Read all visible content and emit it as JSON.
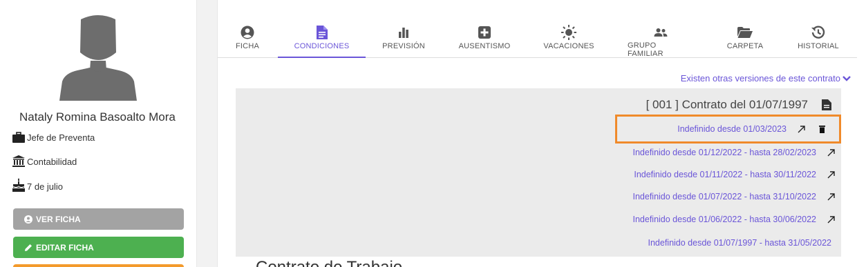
{
  "profile": {
    "name": "Nataly Romina Basoalto Mora",
    "position": "Jefe de Preventa",
    "department": "Contabilidad",
    "birthday": "7 de julio",
    "icons": [
      "user-silhouette",
      "briefcase-icon",
      "bank-icon",
      "cake-icon"
    ],
    "buttons": {
      "view_label": "VER FICHA",
      "edit_label": "EDITAR FICHA"
    },
    "colors": {
      "grey_button": "#a3a3a3",
      "green_button": "#4db050",
      "orange_button": "#f39a2c"
    }
  },
  "tabs": [
    {
      "label": "FICHA",
      "icon": "user-circle-icon",
      "active": false
    },
    {
      "label": "CONDICIONES",
      "icon": "file-text-icon",
      "active": true
    },
    {
      "label": "PREVISIÓN",
      "icon": "bar-chart-icon",
      "active": false
    },
    {
      "label": "AUSENTISMO",
      "icon": "plus-square-icon",
      "active": false
    },
    {
      "label": "VACACIONES",
      "icon": "sun-icon",
      "active": false
    },
    {
      "label": "GRUPO FAMILIAR",
      "icon": "users-icon",
      "active": false
    },
    {
      "label": "CARPETA",
      "icon": "folder-open-icon",
      "active": false
    },
    {
      "label": "HISTORIAL",
      "icon": "history-icon",
      "active": false
    }
  ],
  "versions_link": "Existen otras versiones de este contrato",
  "contract": {
    "title": "[ 001 ] Contrato del 01/07/1997",
    "periods": [
      {
        "label": "Indefinido desde 01/03/2023",
        "actions": [
          "expand-icon",
          "trash-icon"
        ],
        "highlighted": true
      },
      {
        "label": "Indefinido desde 01/12/2022 - hasta 28/02/2023",
        "actions": [
          "expand-icon"
        ]
      },
      {
        "label": "Indefinido desde 01/11/2022 - hasta 30/11/2022",
        "actions": [
          "expand-icon"
        ]
      },
      {
        "label": "Indefinido desde 01/07/2022 - hasta 31/10/2022",
        "actions": [
          "expand-icon"
        ]
      },
      {
        "label": "Indefinido desde 01/06/2022 - hasta 30/06/2022",
        "actions": [
          "expand-icon"
        ]
      },
      {
        "label": "Indefinido desde 01/07/1997 - hasta 31/05/2022",
        "actions": []
      }
    ]
  },
  "bottom_heading": "Contrato de Trabajo",
  "colors": {
    "accent": "#6a55d8",
    "highlight": "#f08a2a",
    "panel_bg": "#ebebeb"
  }
}
